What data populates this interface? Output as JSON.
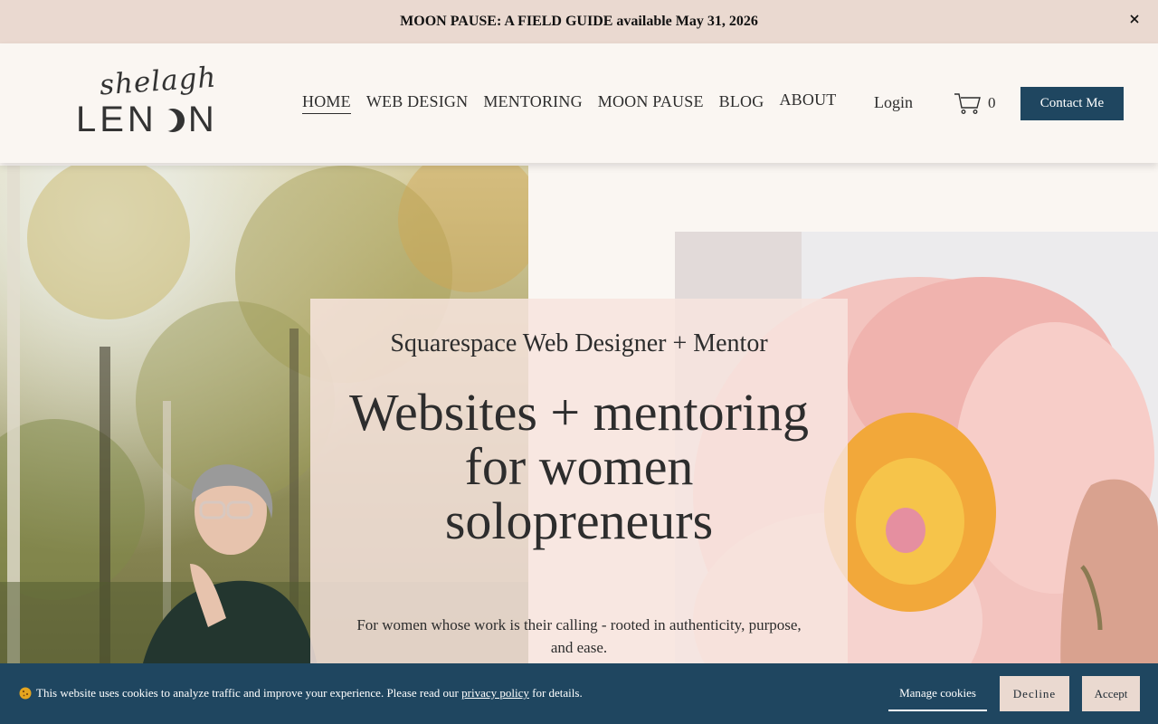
{
  "announcement": {
    "text": "MOON PAUSE: A FIELD GUIDE available May 31, 2026",
    "close_icon": "close-icon"
  },
  "logo": {
    "script": "shelagh",
    "main_before": "LEN",
    "main_after": "N",
    "moon_icon": "crescent-moon-icon"
  },
  "nav": {
    "items": [
      {
        "label": "HOME",
        "active": true
      },
      {
        "label": "WEB DESIGN"
      },
      {
        "label": "MENTORING"
      },
      {
        "label": "MOON PAUSE"
      },
      {
        "label": "BLOG"
      },
      {
        "label": "ABOUT"
      }
    ],
    "login": "Login",
    "cart_count": "0",
    "cart_icon": "cart-icon",
    "contact": "Contact Me"
  },
  "hero": {
    "subtitle": "Squarespace Web Designer + Mentor",
    "headline": "Websites + mentoring for women solopreneurs",
    "blurb": "For women whose work is their calling - rooted in authenticity, purpose, and ease.",
    "left_photo": "portrait-photo",
    "right_photo": "peony-photo"
  },
  "cookie": {
    "text_before": "This website uses cookies to analyze traffic and improve your experience. Please read our ",
    "link": "privacy policy",
    "text_after": " for details.",
    "manage": "Manage cookies",
    "decline": "Decline",
    "accept": "Accept"
  },
  "colors": {
    "accent": "#1f4660",
    "announce_bg": "#ead9d0",
    "page_bg": "#faf6f2"
  }
}
